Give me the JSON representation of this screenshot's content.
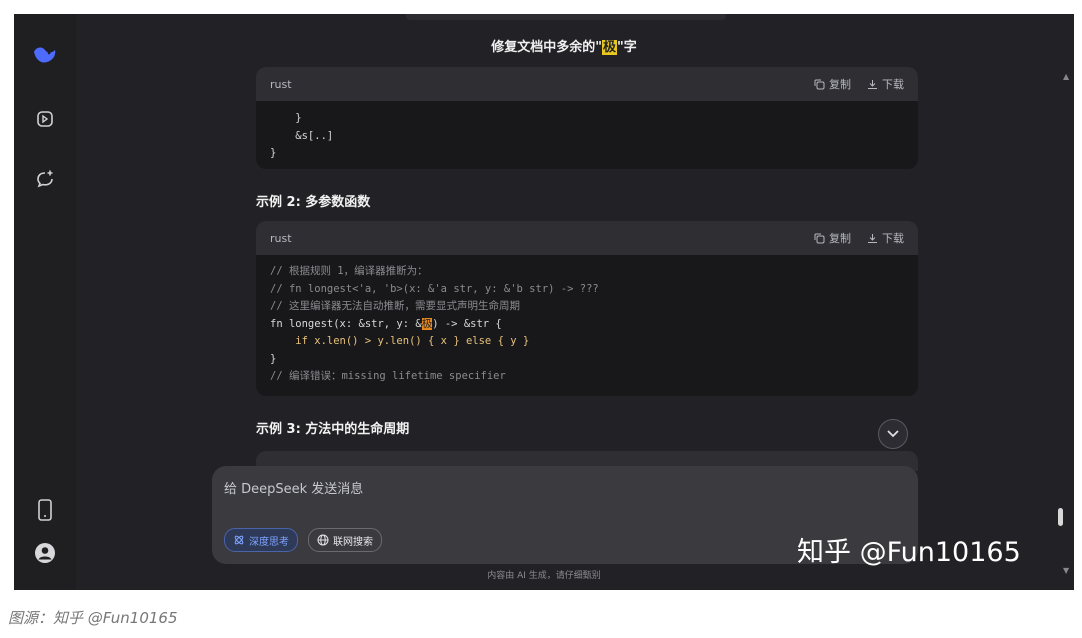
{
  "page": {
    "title_pre": "修复文档中多余的\"",
    "title_hl": "极",
    "title_post": "\"字"
  },
  "code1": {
    "lang": "rust",
    "copy": "复制",
    "download": "下载",
    "lines": [
      "    }",
      "    &s[..]",
      "}"
    ]
  },
  "heading2": "示例 2: 多参数函数",
  "code2": {
    "lang": "rust",
    "copy": "复制",
    "download": "下载",
    "l1": "// 根据规则 1，编译器推断为：",
    "l2": "// fn longest<'a, 'b>(x: &'a str, y: &'b str) -> ???",
    "l3": "// 这里编译器无法自动推断，需要显式声明生命周期",
    "l4_a": "fn longest(x: &str, y: &",
    "l4_hl": "极",
    "l4_b": ") -> &str {",
    "l5": "    if x.len() > y.len() { x } else { y }",
    "l6": "}",
    "l7": "// 编译错误：missing lifetime specifier"
  },
  "heading3": "示例 3: 方法中的生命周期",
  "input": {
    "placeholder": "给 DeepSeek 发送消息",
    "deep_think": "深度思考",
    "web_search": "联网搜索"
  },
  "footer": "内容由 AI 生成，请仔细甄别",
  "watermark": "知乎 @Fun10165",
  "caption": "图源：知乎 @Fun10165",
  "colors": {
    "accent": "#4d6bfe",
    "highlight": "#e8c820"
  }
}
